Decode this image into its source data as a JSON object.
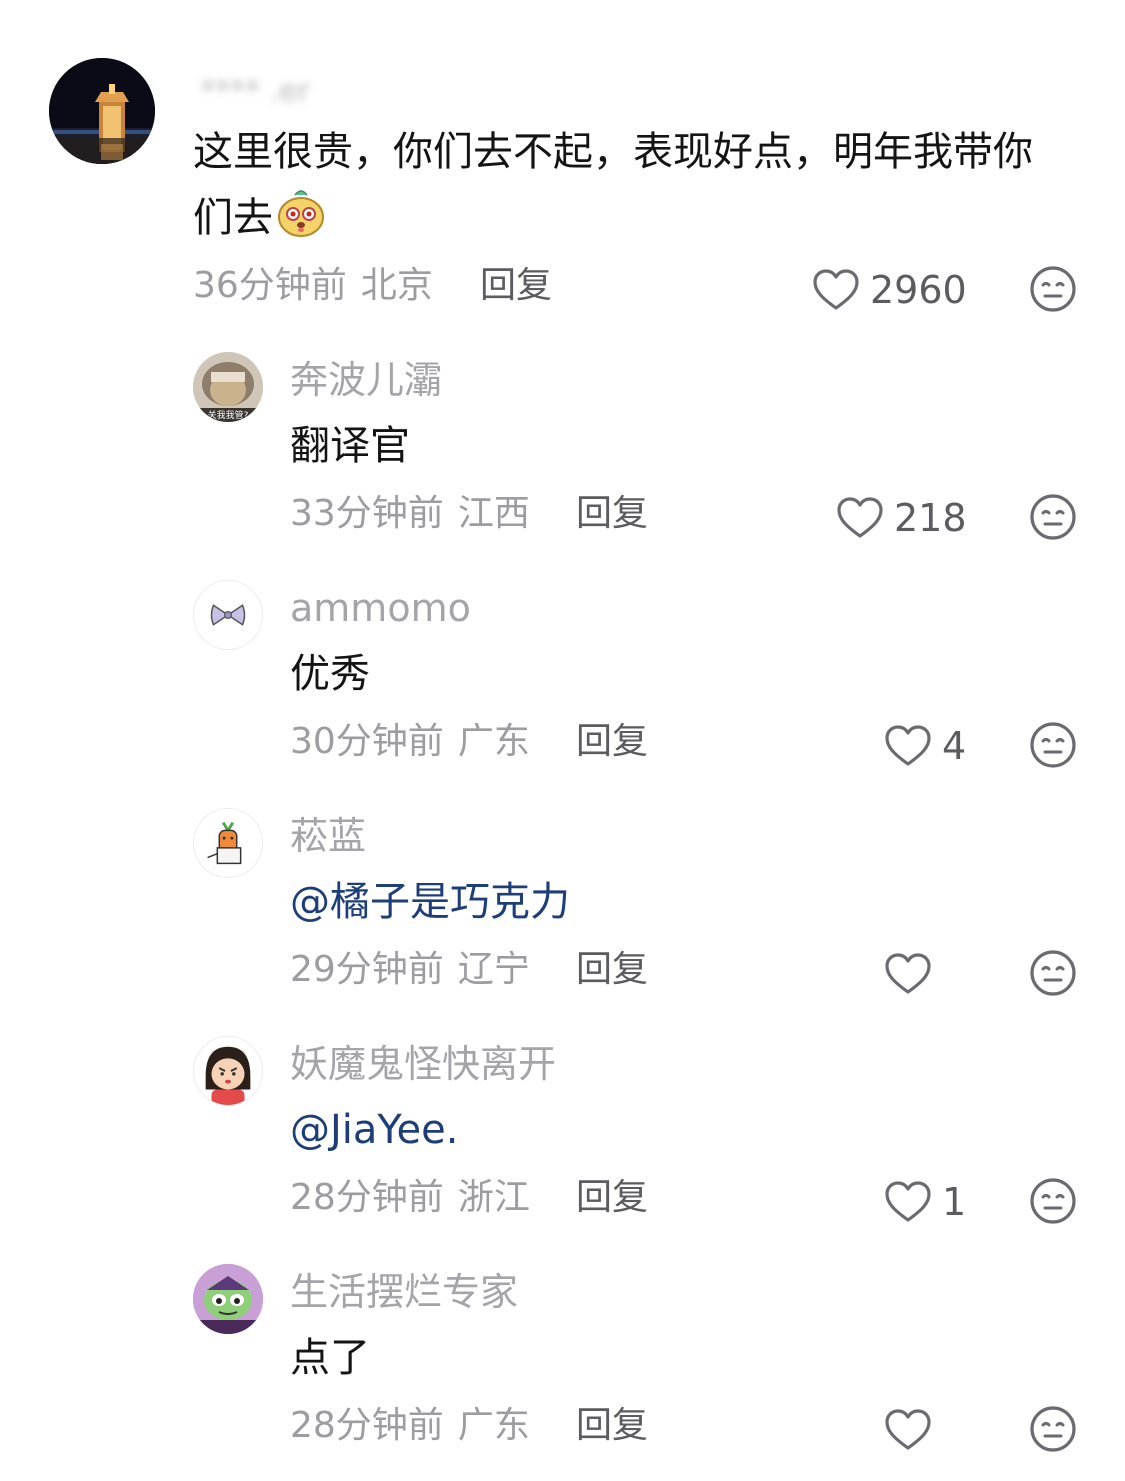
{
  "comments": [
    {
      "username": "**** .er",
      "text_line1": "这里很贵，你们去不起，表现好点，明年我带你",
      "text_line2": "们去",
      "emoji_icon": "dog-face-emoji-icon",
      "time": "36分钟前",
      "location": "北京",
      "reply_label": "回复",
      "likes": "2960"
    },
    {
      "username": "奔波儿灞",
      "avatar_caption": "关我我管?",
      "text": "翻译官",
      "time": "33分钟前",
      "location": "江西",
      "reply_label": "回复",
      "likes": "218"
    },
    {
      "username": "ammomo",
      "text": "优秀",
      "time": "30分钟前",
      "location": "广东",
      "reply_label": "回复",
      "likes": "4"
    },
    {
      "username": "菘蓝",
      "text": "@橘子是巧克力",
      "time": "29分钟前",
      "location": "辽宁",
      "reply_label": "回复",
      "likes": ""
    },
    {
      "username": "妖魔鬼怪快离开",
      "text": "@JiaYee.",
      "time": "28分钟前",
      "location": "浙江",
      "reply_label": "回复",
      "likes": "1"
    },
    {
      "username": "生活摆烂专家",
      "text": "点了",
      "time": "28分钟前",
      "location": "广东",
      "reply_label": "回复",
      "likes": ""
    }
  ],
  "icons": {
    "like": "heart-outline-icon",
    "dislike": "neutral-face-icon"
  },
  "colors": {
    "text": "#141414",
    "username": "#a4a4a9",
    "meta": "#9c9ca1",
    "mention": "#1d3e78"
  }
}
